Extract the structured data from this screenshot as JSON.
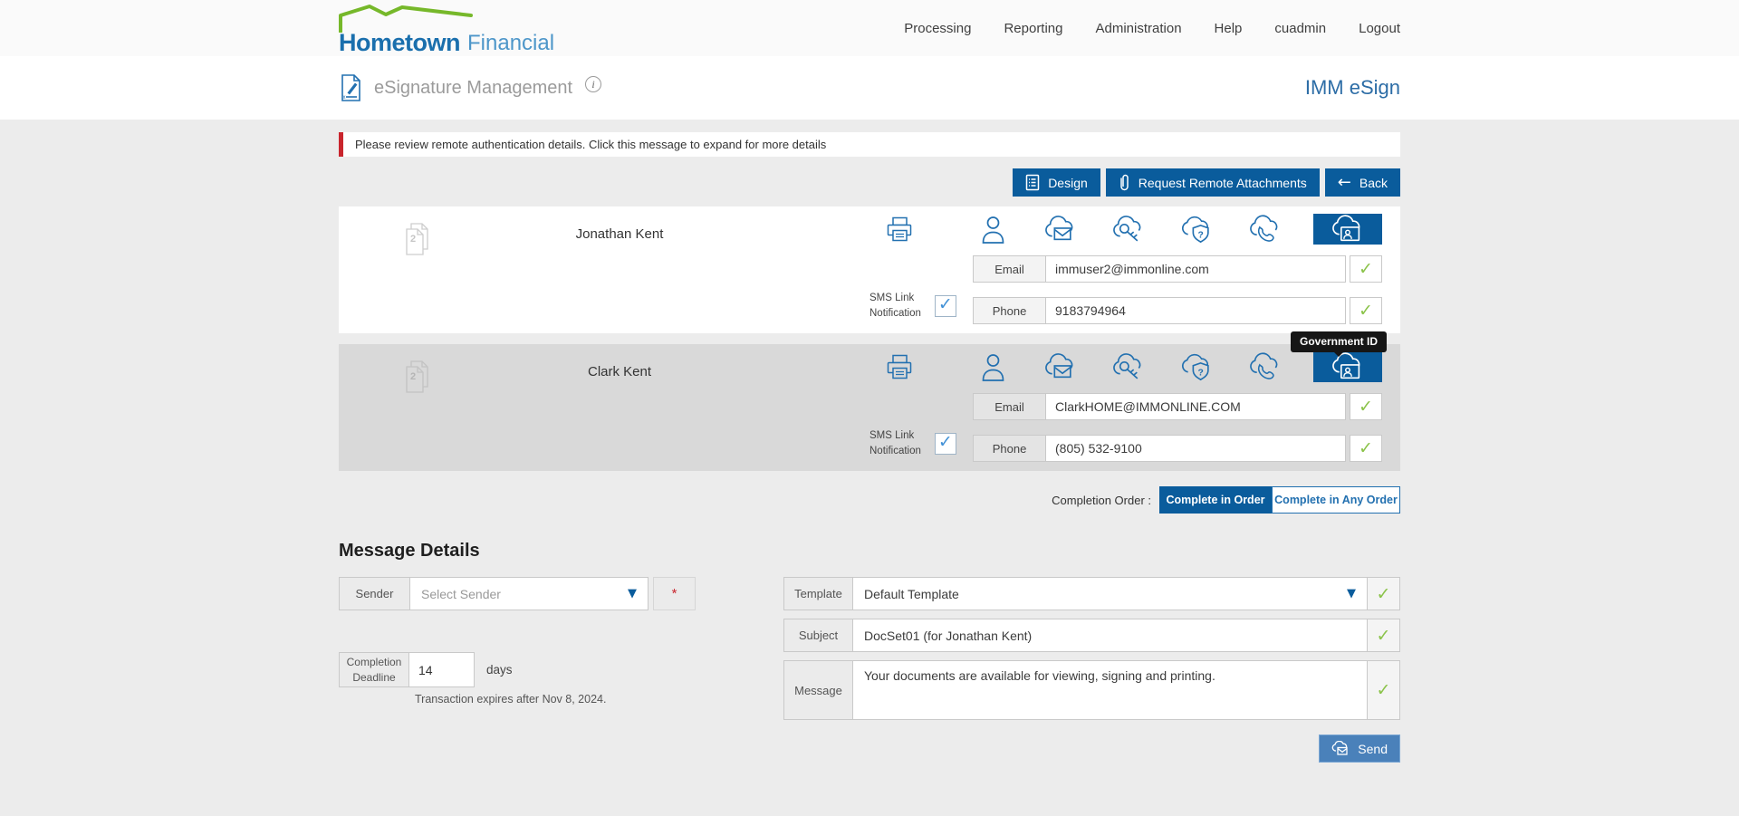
{
  "colors": {
    "accent_blue": "#0a5c9c",
    "icon_blue": "#2270b0",
    "brand_blue": "#1a6fad",
    "brand_light_blue": "#4d96c9",
    "brand_green": "#76b82a",
    "alert_red": "#c9252d",
    "check_green": "#8bc34a",
    "selected_row_gray": "#d9d9d9"
  },
  "brand": {
    "name_bold": "Hometown",
    "name_light": "Financial"
  },
  "nav": {
    "items": {
      "processing": "Processing",
      "reporting": "Reporting",
      "administration": "Administration",
      "help": "Help",
      "user": "cuadmin",
      "logout": "Logout"
    }
  },
  "header": {
    "title": "eSignature Management",
    "info_icon": "i",
    "product": "IMM eSign"
  },
  "alert": {
    "text": "Please review remote authentication details. Click this message to expand for more details"
  },
  "toolbar": {
    "design_label": "Design",
    "request_remote_attachments_label": "Request Remote Attachments",
    "back_label": "Back",
    "back_arrow": "←",
    "icons": [
      "design-document-icon",
      "paperclip-icon",
      "back-arrow-icon"
    ]
  },
  "recipient_icons": [
    "printer-icon",
    "recipient-person-icon",
    "remote-email-icon",
    "remote-password-icon",
    "remote-security-question-icon",
    "remote-phone-icon",
    "government-id-icon"
  ],
  "recipients": {
    "0": {
      "name": "Jonathan Kent",
      "doc_count": "2",
      "email_label": "Email",
      "email": "immuser2@immonline.com",
      "phone_label": "Phone",
      "phone": "9183794964",
      "sms_line1": "SMS Link",
      "sms_line2": "Notification",
      "check": "✓"
    },
    "1": {
      "name": "Clark Kent",
      "doc_count": "2",
      "email_label": "Email",
      "email": "ClarkHOME@IMMONLINE.COM",
      "phone_label": "Phone",
      "phone": "(805) 532-9100",
      "sms_line1": "SMS Link",
      "sms_line2": "Notification",
      "check": "✓",
      "tooltip": "Government ID"
    }
  },
  "completion_order": {
    "label": "Completion Order :",
    "in_order": "Complete in Order",
    "any_order": "Complete in Any Order",
    "selected": "Complete in Order"
  },
  "message_details": {
    "heading": "Message Details",
    "sender_label": "Sender",
    "sender_placeholder": "Select Sender",
    "required_marker": "*",
    "deadline_label_line1": "Completion",
    "deadline_label_line2": "Deadline",
    "deadline_value": "14",
    "deadline_unit": "days",
    "expiry_note": "Transaction expires after Nov 8, 2024.",
    "template_label": "Template",
    "template_value": "Default Template",
    "subject_label": "Subject",
    "subject_value": "DocSet01 (for Jonathan Kent)",
    "message_label": "Message",
    "message_value": "Your documents are available for viewing, signing and printing.",
    "send_label": "Send",
    "check": "✓"
  },
  "glyphs": {
    "caret_down": "▼",
    "check": "✓"
  }
}
